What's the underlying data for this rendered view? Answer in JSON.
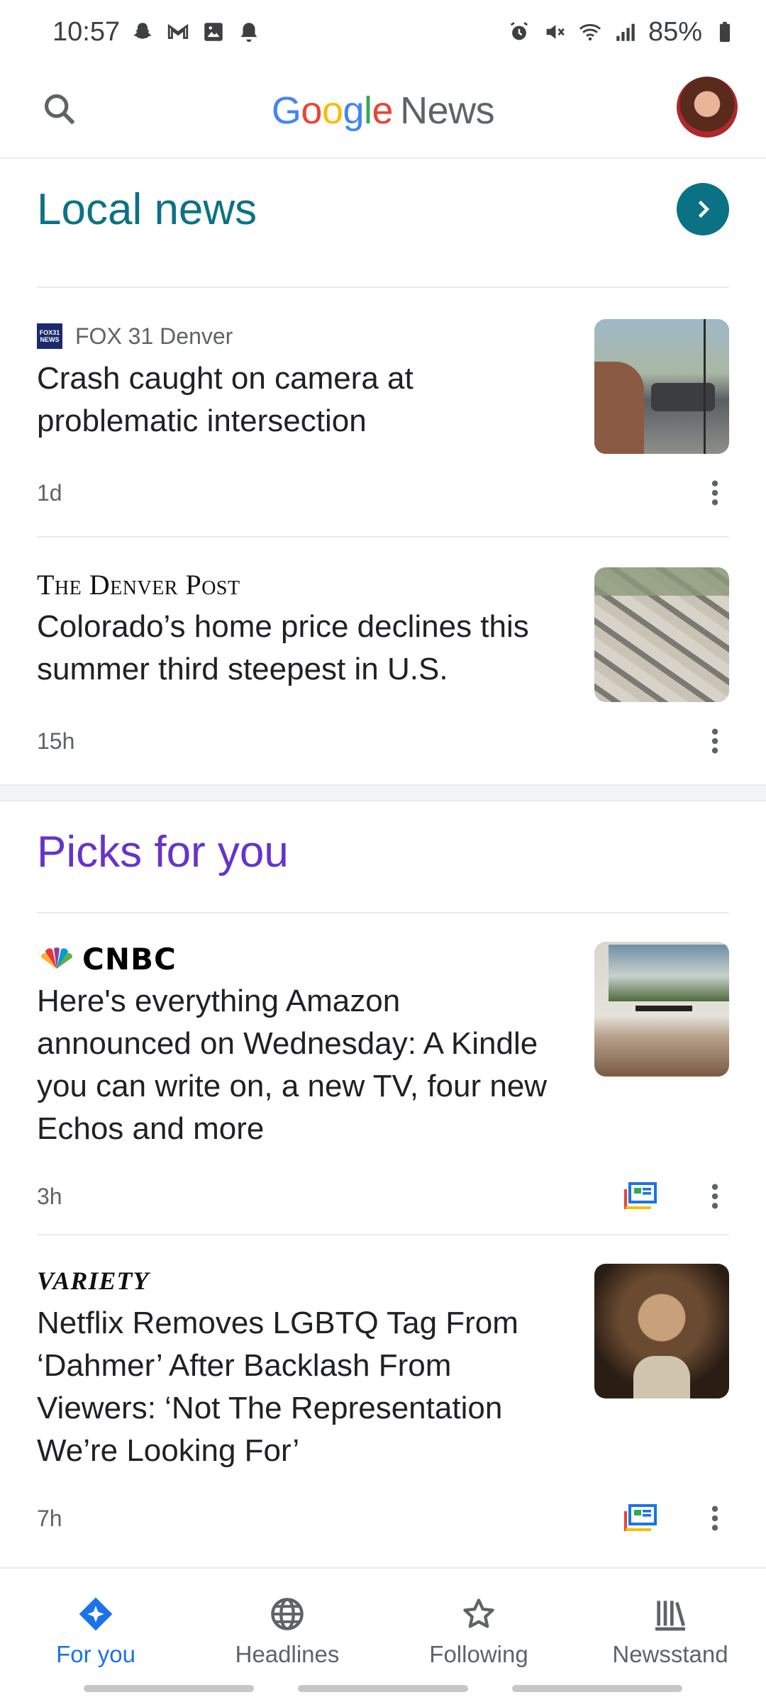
{
  "status_bar": {
    "time": "10:57",
    "battery": "85%"
  },
  "app_bar": {
    "logo_letters": [
      "G",
      "o",
      "o",
      "g",
      "l",
      "e"
    ],
    "logo_suffix": "News"
  },
  "local_news": {
    "title": "Local news",
    "articles": [
      {
        "source": "FOX 31 Denver",
        "source_logo_text": "FOX31 NEWS",
        "headline": "Crash caught on camera at problematic intersection",
        "age": "1d"
      },
      {
        "source": "The Denver Post",
        "headline": "Colorado’s home price declines this summer third steepest in U.S.",
        "age": "15h"
      }
    ]
  },
  "picks": {
    "title": "Picks for you",
    "articles": [
      {
        "source": "CNBC",
        "headline": "Here's everything Amazon announced on Wednesday: A Kindle you can write on, a new TV, four new Echos and more",
        "age": "3h"
      },
      {
        "source": "VARIETY",
        "headline": "Netflix Removes LGBTQ Tag From ‘Dahmer’ After Backlash From Viewers: ‘Not The Representation We’re Looking For’",
        "age": "7h"
      }
    ]
  },
  "bottom_nav": {
    "items": [
      {
        "label": "For you",
        "icon": "for-you-icon",
        "active": true
      },
      {
        "label": "Headlines",
        "icon": "globe-icon",
        "active": false
      },
      {
        "label": "Following",
        "icon": "star-icon",
        "active": false
      },
      {
        "label": "Newsstand",
        "icon": "newsstand-icon",
        "active": false
      }
    ]
  },
  "colors": {
    "local_accent": "#0b7285",
    "picks_accent": "#6633cc",
    "active_nav": "#1a73e8"
  }
}
